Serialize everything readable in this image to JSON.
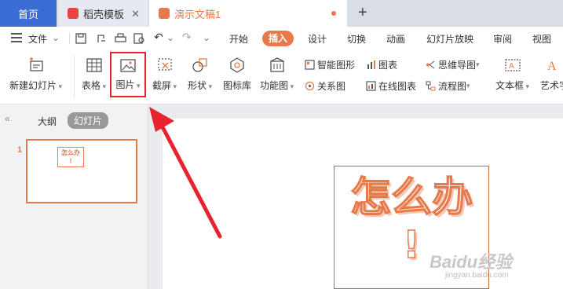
{
  "tabs": {
    "home": "首页",
    "templates": "稻壳模板",
    "document": "演示文稿1",
    "new_tab": "+"
  },
  "menu": {
    "file": "文件",
    "items": [
      "开始",
      "插入",
      "设计",
      "切换",
      "动画",
      "幻灯片放映",
      "审阅",
      "视图"
    ],
    "active": "插入"
  },
  "ribbon": {
    "new_slide": "新建幻灯片",
    "table": "表格",
    "picture": "图片",
    "screenshot": "截屏",
    "shape": "形状",
    "icon_library": "图标库",
    "function_chart": "功能图",
    "smart_shape": "智能图形",
    "chart": "图表",
    "relation_chart": "关系图",
    "online_chart": "在线图表",
    "mind_map": "思维导图",
    "flowchart": "流程图",
    "text_box": "文本框",
    "art_text": "艺术字"
  },
  "left_panel": {
    "outline_tab": "大纲",
    "slides_tab": "幻灯片",
    "slide_number": "1"
  },
  "slide": {
    "title_text": "怎么办",
    "exclamation": "!"
  },
  "watermark": {
    "brand": "Baidu经验",
    "url": "jingyan.baidu.com"
  },
  "colors": {
    "accent_orange": "#e8794a",
    "home_tab_blue": "#3b6cd4",
    "highlight_red": "#e8232f"
  }
}
